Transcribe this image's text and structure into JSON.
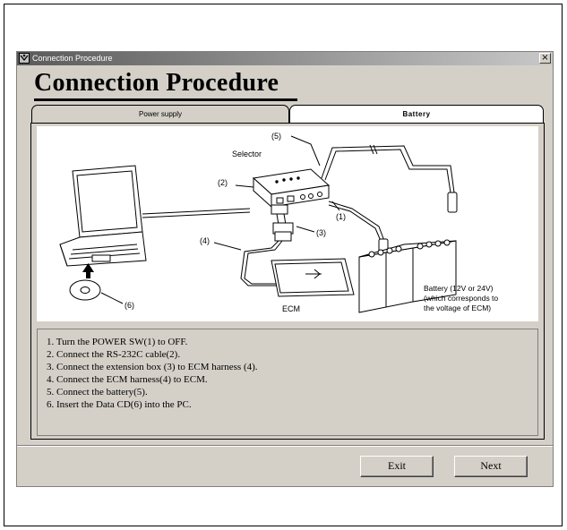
{
  "window": {
    "title": "Connection Procedure",
    "close_symbol": "×"
  },
  "heading": "Connection Procedure",
  "tabs": [
    {
      "label": "Power supply",
      "active": false
    },
    {
      "label": "Battery",
      "active": true
    }
  ],
  "diagram": {
    "labels": {
      "selector": "Selector",
      "ecm": "ECM",
      "n1": "(1)",
      "n2": "(2)",
      "n3": "(3)",
      "n4": "(4)",
      "n5": "(5)",
      "n6": "(6)",
      "battery_line1": "Battery (12V or 24V)",
      "battery_line2": "(which corresponds to",
      "battery_line3": "the voltage of ECM)"
    }
  },
  "steps": [
    "1. Turn the POWER SW(1) to OFF.",
    "2. Connect the RS-232C cable(2).",
    "3. Connect the extension box (3) to ECM harness (4).",
    "4. Connect the ECM harness(4) to ECM.",
    "5. Connect the battery(5).",
    "6. Insert the Data CD(6) into the PC."
  ],
  "buttons": {
    "exit": "Exit",
    "next": "Next"
  }
}
